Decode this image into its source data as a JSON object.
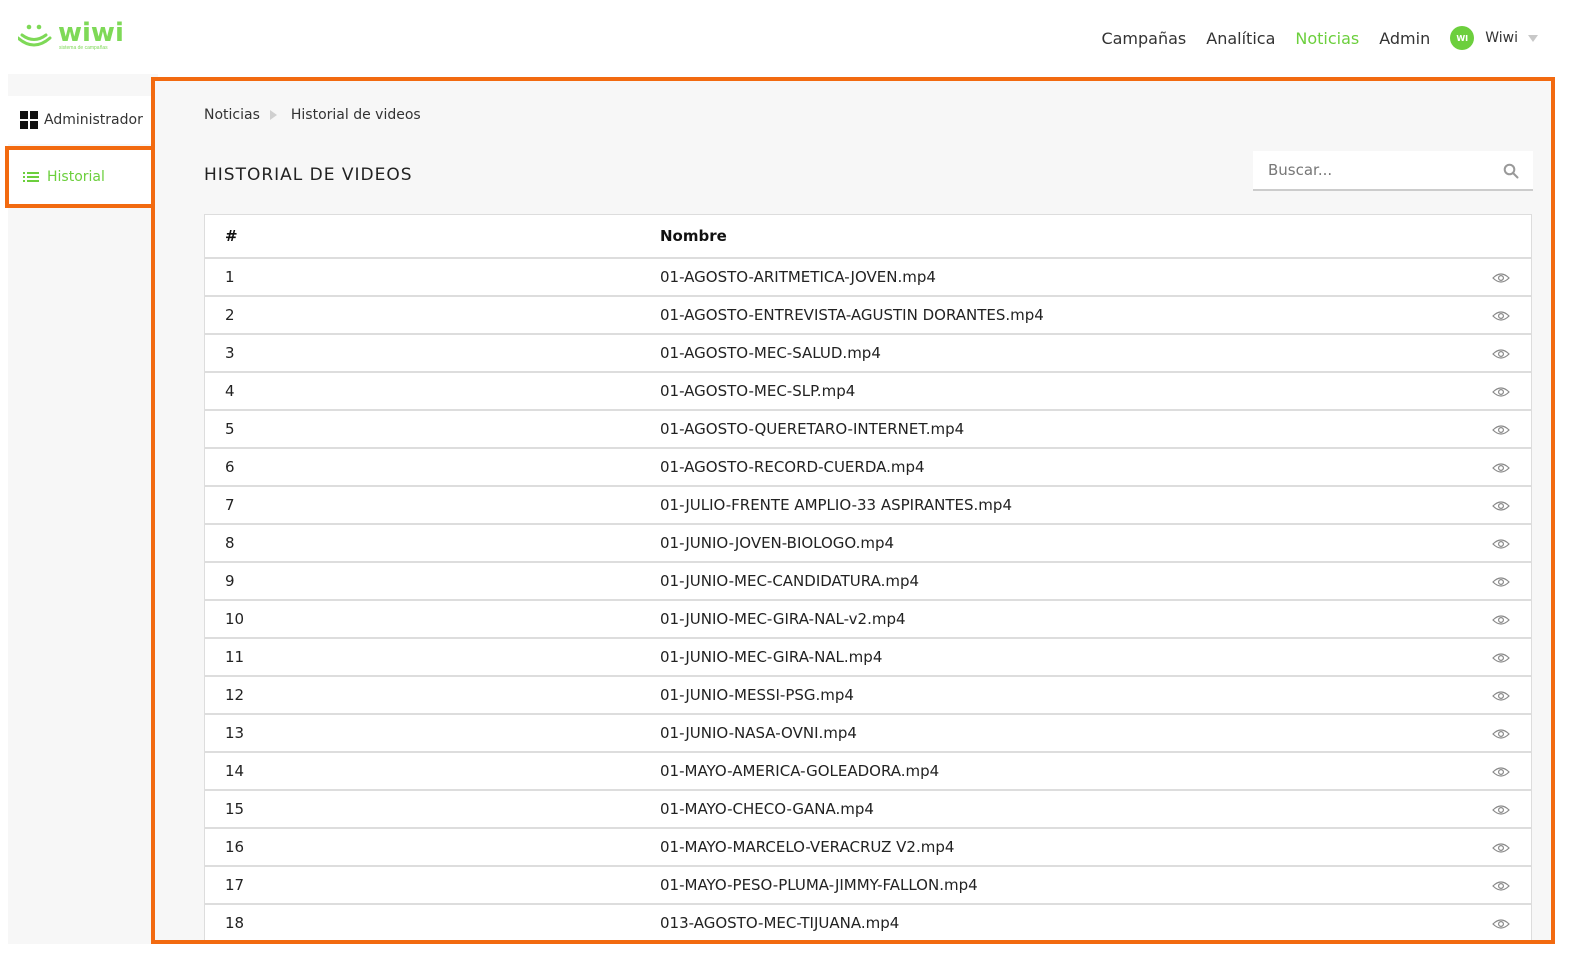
{
  "brand": {
    "name": "wiwi",
    "tagline": "sistema de campañas",
    "logo_color": "#7ed957"
  },
  "nav": {
    "items": [
      {
        "label": "Campañas",
        "active": false
      },
      {
        "label": "Analítica",
        "active": false
      },
      {
        "label": "Noticias",
        "active": true
      },
      {
        "label": "Admin",
        "active": false
      }
    ],
    "user": {
      "initials": "WI",
      "name": "Wiwi"
    }
  },
  "sidebar": {
    "items": [
      {
        "label": "Administrador",
        "icon": "grid-icon",
        "active": false
      },
      {
        "label": "Historial",
        "icon": "list-icon",
        "active": true
      }
    ]
  },
  "breadcrumb": [
    "Noticias",
    "Historial de videos"
  ],
  "page_title": "HISTORIAL DE VIDEOS",
  "search": {
    "placeholder": "Buscar...",
    "value": ""
  },
  "table": {
    "columns": [
      "#",
      "Nombre",
      ""
    ],
    "rows": [
      {
        "num": "1",
        "name": "01-AGOSTO-ARITMETICA-JOVEN.mp4"
      },
      {
        "num": "2",
        "name": "01-AGOSTO-ENTREVISTA-AGUSTIN DORANTES.mp4"
      },
      {
        "num": "3",
        "name": "01-AGOSTO-MEC-SALUD.mp4"
      },
      {
        "num": "4",
        "name": "01-AGOSTO-MEC-SLP.mp4"
      },
      {
        "num": "5",
        "name": "01-AGOSTO-QUERETARO-INTERNET.mp4"
      },
      {
        "num": "6",
        "name": "01-AGOSTO-RECORD-CUERDA.mp4"
      },
      {
        "num": "7",
        "name": "01-JULIO-FRENTE AMPLIO-33 ASPIRANTES.mp4"
      },
      {
        "num": "8",
        "name": "01-JUNIO-JOVEN-BIOLOGO.mp4"
      },
      {
        "num": "9",
        "name": "01-JUNIO-MEC-CANDIDATURA.mp4"
      },
      {
        "num": "10",
        "name": "01-JUNIO-MEC-GIRA-NAL-v2.mp4"
      },
      {
        "num": "11",
        "name": "01-JUNIO-MEC-GIRA-NAL.mp4"
      },
      {
        "num": "12",
        "name": "01-JUNIO-MESSI-PSG.mp4"
      },
      {
        "num": "13",
        "name": "01-JUNIO-NASA-OVNI.mp4"
      },
      {
        "num": "14",
        "name": "01-MAYO-AMERICA-GOLEADORA.mp4"
      },
      {
        "num": "15",
        "name": "01-MAYO-CHECO-GANA.mp4"
      },
      {
        "num": "16",
        "name": "01-MAYO-MARCELO-VERACRUZ V2.mp4"
      },
      {
        "num": "17",
        "name": "01-MAYO-PESO-PLUMA-JIMMY-FALLON.mp4"
      },
      {
        "num": "18",
        "name": "013-AGOSTO-MEC-TIJUANA.mp4"
      }
    ]
  },
  "colors": {
    "accent": "#6ccf3d",
    "highlight_border": "#f26a10"
  }
}
